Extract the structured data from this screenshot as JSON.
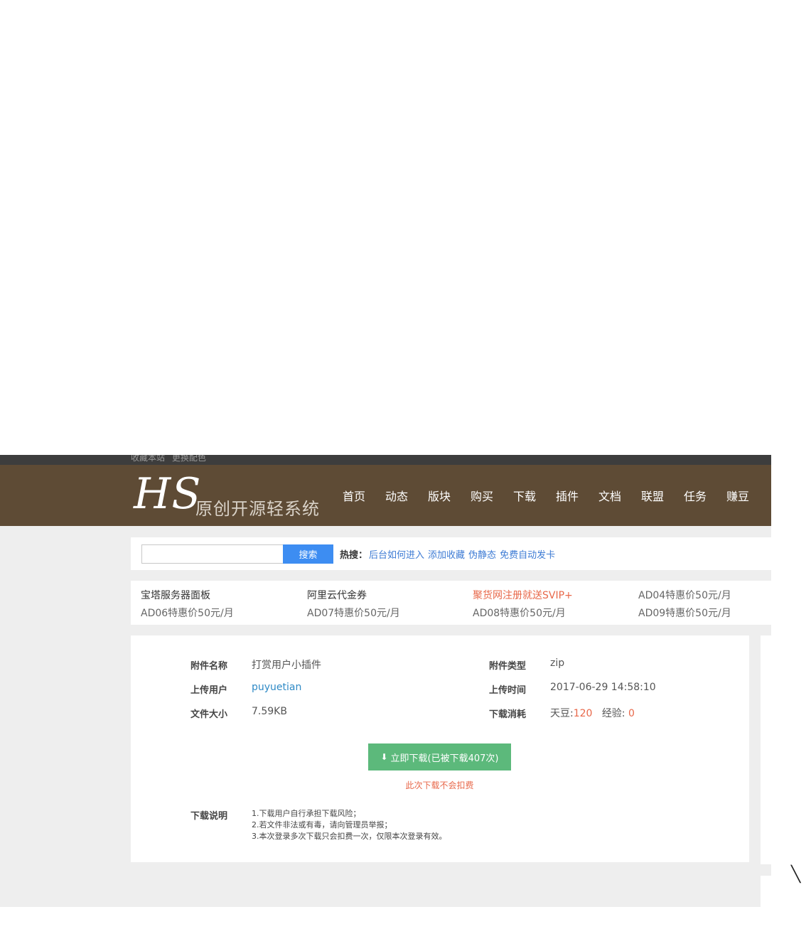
{
  "topbar": {
    "links": [
      "收藏本站",
      "更换配色"
    ]
  },
  "header": {
    "logo": "HS",
    "tagline": "原创开源轻系统",
    "nav": [
      "首页",
      "动态",
      "版块",
      "购买",
      "下载",
      "插件",
      "文档",
      "联盟",
      "任务",
      "赚豆"
    ]
  },
  "search": {
    "placeholder": "",
    "button": "搜索",
    "hot_label": "热搜：",
    "hot_links": [
      "后台如何进入",
      "添加收藏",
      "伪静态",
      "免费自动发卡"
    ]
  },
  "ads": [
    [
      "宝塔服务器面板",
      "阿里云代金券",
      "聚货网注册就送SVIP+",
      "AD04特惠价50元/月"
    ],
    [
      "AD06特惠价50元/月",
      "AD07特惠价50元/月",
      "AD08特惠价50元/月",
      "AD09特惠价50元/月"
    ]
  ],
  "attachment": {
    "name_label": "附件名称",
    "name": "打赏用户小插件",
    "type_label": "附件类型",
    "type": "zip",
    "uploader_label": "上传用户",
    "uploader": "puyuetian",
    "time_label": "上传时间",
    "time": "2017-06-29 14:58:10",
    "size_label": "文件大小",
    "size": "7.59KB",
    "cost_label": "下载消耗",
    "cost_coin_label": "天豆:",
    "cost_coin": "120",
    "cost_exp_label": "经验:",
    "cost_exp": "0",
    "download_button": "立即下载(已被下载407次)",
    "download_note": "此次下载不会扣费",
    "desc_label": "下载说明",
    "desc_lines": [
      "1.下载用户自行承担下载风险；",
      "2.若文件非法或有毒，请向管理员举报；",
      "3.本次登录多次下载只会扣费一次，仅限本次登录有效。"
    ]
  }
}
